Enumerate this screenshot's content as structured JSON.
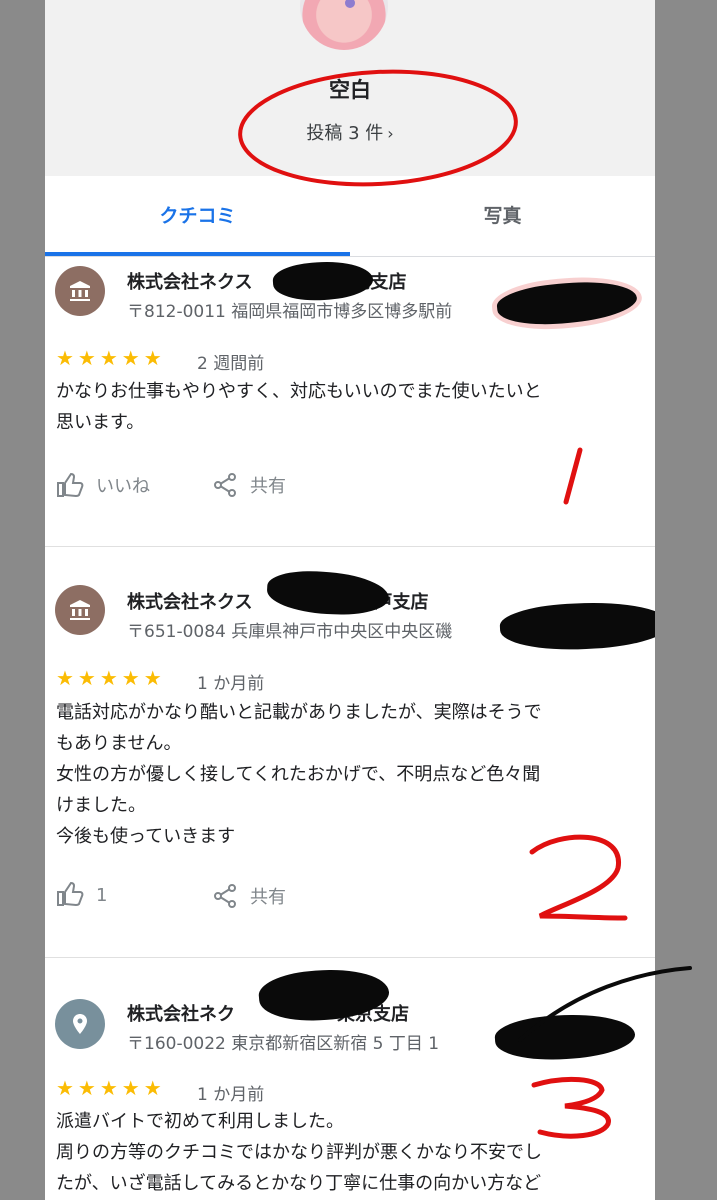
{
  "profile": {
    "name": "空白",
    "posts_label": "投稿 3 件",
    "chevron": "›"
  },
  "tabs": [
    {
      "label": "クチコミ",
      "active": true
    },
    {
      "label": "写真",
      "active": false
    }
  ],
  "colors": {
    "accent": "#1a73e8",
    "star": "#fbbc04",
    "annotation_red": "#e01010"
  },
  "reviews": [
    {
      "place_name_prefix": "株式会社ネクス",
      "place_name_suffix": "福岡支店",
      "address": "〒812-0011 福岡県福岡市博多区博多駅前",
      "icon": "bank-icon",
      "stars": "★★★★★",
      "rating": 5,
      "when": "2 週間前",
      "text": "かなりお仕事もやりやすく、対応もいいのでまた使いたいと\n思います。",
      "like_label": "いいね",
      "share_label": "共有",
      "annotation": "1"
    },
    {
      "place_name_prefix": "株式会社ネクス",
      "place_name_suffix": "神戸支店",
      "address": "〒651-0084 兵庫県神戸市中央区中央区磯",
      "icon": "bank-icon",
      "stars": "★★★★★",
      "rating": 5,
      "when": "1 か月前",
      "text": "電話対応がかなり酷いと記載がありましたが、実際はそうで\nもありません。\n女性の方が優しく接してくれたおかげで、不明点など色々聞\nけました。\n今後も使っていきます",
      "like_label": "1",
      "share_label": "共有",
      "annotation": "2"
    },
    {
      "place_name_prefix": "株式会社ネク",
      "place_name_suffix": "東京支店",
      "address": "〒160-0022 東京都新宿区新宿 5 丁目 1",
      "icon": "map-pin-icon",
      "stars": "★★★★★",
      "rating": 5,
      "when": "1 か月前",
      "text": "派遣バイトで初めて利用しました。\n周りの方等のクチコミではかなり評判が悪くかなり不安でし\nたが、いざ電話してみるとかなり丁寧に仕事の向かい方など",
      "annotation": "3"
    }
  ]
}
